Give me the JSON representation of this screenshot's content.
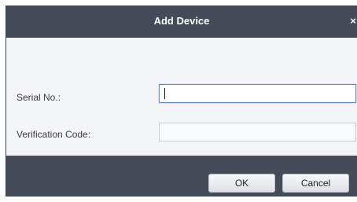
{
  "dialog": {
    "title": "Add Device",
    "close_label": "×"
  },
  "fields": {
    "serial": {
      "label": "Serial No.:",
      "value": "",
      "placeholder": ""
    },
    "verification": {
      "label": "Verification Code:",
      "value": "",
      "placeholder": ""
    }
  },
  "buttons": {
    "ok_label": "OK",
    "cancel_label": "Cancel"
  },
  "colors": {
    "titlebar": "#444c59",
    "body": "#f4f5f8",
    "focus_border": "#5a8fd6"
  }
}
